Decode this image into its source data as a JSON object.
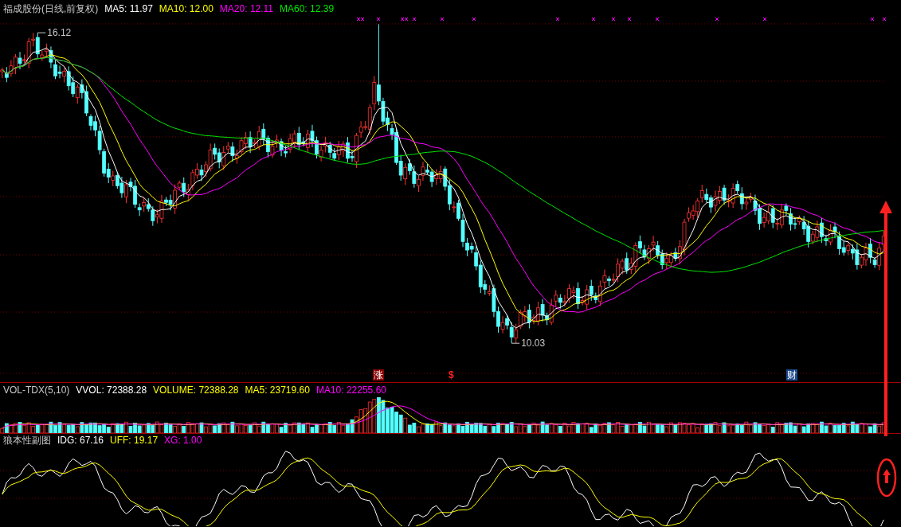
{
  "main_panel": {
    "title": "福成股份(日线,前复权)",
    "indicators": [
      {
        "label": "MA5: 11.97",
        "color": "#ffffff"
      },
      {
        "label": "MA10: 12.00",
        "color": "#ffff00"
      },
      {
        "label": "MA20: 12.11",
        "color": "#ff00ff"
      },
      {
        "label": "MA60: 12.39",
        "color": "#00e600"
      }
    ],
    "high_label": "16.12",
    "low_label": "10.03",
    "event_markers": [
      {
        "text": "涨",
        "kind": "tag",
        "color": "#8b0000"
      },
      {
        "text": "$",
        "kind": "signal",
        "color": "#ff2020"
      },
      {
        "text": "财",
        "kind": "tag",
        "color": "#1e4a8c"
      }
    ]
  },
  "volume_panel": {
    "title": "VOL-TDX(5,10)",
    "indicators": [
      {
        "label": "VVOL: 72388.28",
        "color": "#ffffff"
      },
      {
        "label": "VOLUME: 72388.28",
        "color": "#ffff00"
      },
      {
        "label": "MA5: 23719.60",
        "color": "#ffff00"
      },
      {
        "label": "MA10: 22255.60",
        "color": "#ff00ff"
      }
    ]
  },
  "sub_panel": {
    "title": "狼本性副图",
    "indicators": [
      {
        "label": "IDG: 67.16",
        "color": "#ffffff"
      },
      {
        "label": "UFF: 19.17",
        "color": "#ffff00"
      },
      {
        "label": "XG: 1.00",
        "color": "#ff00ff"
      }
    ]
  }
}
